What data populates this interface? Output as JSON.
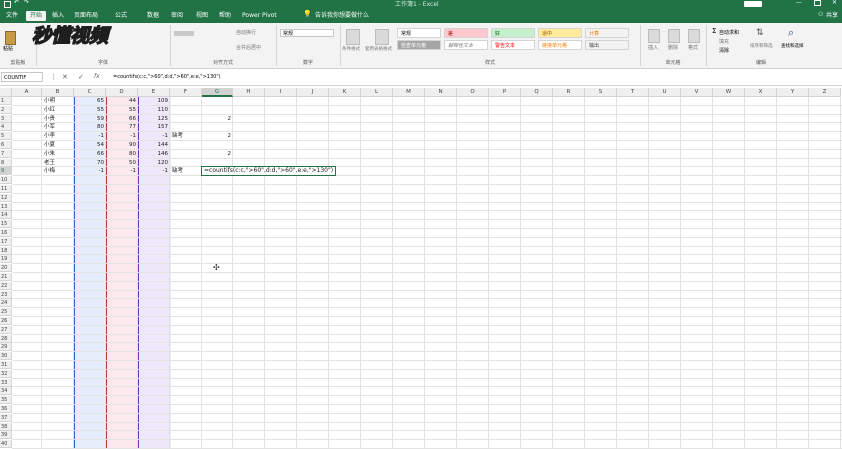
{
  "window": {
    "title": "工作簿1 - Excel"
  },
  "tabs": [
    "文件",
    "开始",
    "插入",
    "页面布局",
    "公式",
    "数据",
    "审阅",
    "视图",
    "帮助",
    "Power Pivot",
    "告诉我你想要做什么"
  ],
  "active_tab": "开始",
  "share_label": "共享",
  "ribbon": {
    "groups": [
      "剪贴板",
      "字体",
      "对齐方式",
      "数字",
      "样式",
      "单元格",
      "编辑"
    ],
    "paste_label": "粘贴",
    "wrap_text": "自动换行",
    "merge_center": "合并后居中",
    "number_format": "常规",
    "cond_format": "条件格式",
    "table_format": "套用表格格式",
    "styles": [
      "常规",
      "差",
      "好",
      "适中",
      "计算",
      "检查单元格",
      "解释性文本",
      "警告文本",
      "链接单元格",
      "输出"
    ],
    "cells": [
      "插入",
      "删除",
      "格式"
    ],
    "autosum": "自动求和",
    "fill": "填充",
    "clear": "清除",
    "sort_filter": "排序和筛选",
    "find_select": "查找和选择"
  },
  "watermark": "秒懂视频",
  "formula_bar": {
    "name_box": "COUNTIF",
    "fx": "fx",
    "formula": "=countifs(c:c,\">60\",d:d,\">60\",e:e,\">130\")"
  },
  "columns": [
    "A",
    "B",
    "C",
    "D",
    "E",
    "F",
    "G",
    "H",
    "I",
    "J",
    "K",
    "L",
    "M",
    "N",
    "O",
    "P",
    "Q",
    "R",
    "S",
    "T",
    "U",
    "V",
    "W",
    "X",
    "Y",
    "Z"
  ],
  "rows": [
    "1",
    "2",
    "3",
    "4",
    "5",
    "6",
    "7",
    "8",
    "9",
    "10",
    "11",
    "12",
    "13",
    "14",
    "15",
    "16",
    "17",
    "18",
    "19",
    "20",
    "21",
    "22",
    "23",
    "24",
    "25",
    "26",
    "27",
    "28",
    "29",
    "30",
    "31",
    "32",
    "33",
    "34",
    "35",
    "36",
    "37",
    "38",
    "39",
    "40"
  ],
  "sheet_rows": [
    {
      "name": "小明",
      "c": "65",
      "d": "44",
      "e": "109",
      "f": "",
      "g": ""
    },
    {
      "name": "小红",
      "c": "55",
      "d": "55",
      "e": "110",
      "f": "",
      "g": ""
    },
    {
      "name": "小贵",
      "c": "59",
      "d": "66",
      "e": "125",
      "f": "",
      "g": "2"
    },
    {
      "name": "小军",
      "c": "80",
      "d": "77",
      "e": "157",
      "f": "",
      "g": ""
    },
    {
      "name": "小李",
      "c": "-1",
      "d": "-1",
      "e": "-1",
      "f": "缺考",
      "g": "2"
    },
    {
      "name": "小夏",
      "c": "54",
      "d": "90",
      "e": "144",
      "f": "",
      "g": ""
    },
    {
      "name": "小朱",
      "c": "66",
      "d": "80",
      "e": "146",
      "f": "",
      "g": "2"
    },
    {
      "name": "老王",
      "c": "70",
      "d": "50",
      "e": "120",
      "f": "",
      "g": ""
    },
    {
      "name": "小梅",
      "c": "-1",
      "d": "-1",
      "e": "-1",
      "f": "缺考",
      "g": ""
    }
  ],
  "editing_cell": {
    "ref": "G9",
    "text": "=countifs(c:c,\">60\",d:d,\">60\",e:e,\">130\")"
  },
  "colors": {
    "excel_green": "#217346",
    "col_c_shade": "#e7eefb",
    "col_d_shade": "#fce9ec",
    "col_e_shade": "#efe8fb"
  }
}
